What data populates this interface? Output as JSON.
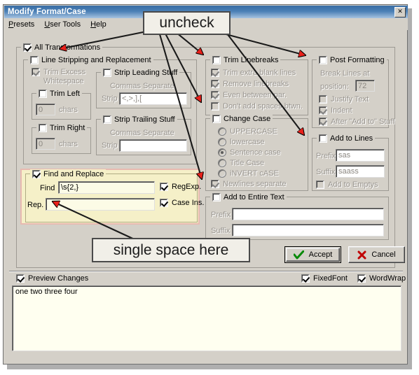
{
  "window": {
    "title": "Modify Format/Case",
    "close_label": "✕",
    "menu": [
      {
        "label": "Presets",
        "accel": "P"
      },
      {
        "label": "User Tools",
        "accel": "U"
      },
      {
        "label": "Help",
        "accel": "H"
      }
    ]
  },
  "all_transformations": {
    "label": "All Transformations",
    "checked": true
  },
  "line_stripping": {
    "label": "Line Stripping and Replacement",
    "checked": false,
    "trim_excess_whitespace": {
      "label_line1": "Trim Excess",
      "label_line2": "Whitespace",
      "checked": true,
      "enabled": false
    },
    "trim_left": {
      "label": "Trim Left",
      "checked": false,
      "value": "0",
      "units": "chars"
    },
    "trim_right": {
      "label": "Trim Right",
      "checked": false,
      "value": "0",
      "units": "chars"
    },
    "strip_leading": {
      "label": "Strip Leading Stuff",
      "checked": false,
      "hint": "Commas Separate",
      "field_label": "Strip",
      "value": "<,>,],["
    },
    "strip_trailing": {
      "label": "Strip Trailing Stuff",
      "checked": false,
      "hint": "Commas Separate",
      "field_label": "Strip",
      "value": ""
    }
  },
  "trim_linebreaks": {
    "label": "Trim Linebreaks",
    "checked": false,
    "items": [
      {
        "label": "Trim extra blank lines",
        "checked": true
      },
      {
        "label": "Remove linebreaks",
        "checked": true
      },
      {
        "label": "Even between par.",
        "checked": true
      },
      {
        "label": "Don't add spaces btwn.",
        "checked": false
      }
    ]
  },
  "change_case": {
    "label": "Change Case",
    "checked": false,
    "options": [
      {
        "label": "UPPERCASE",
        "selected": false
      },
      {
        "label": "lowercase",
        "selected": false
      },
      {
        "label": "Sentence case",
        "selected": true
      },
      {
        "label": "Title Case",
        "selected": false
      },
      {
        "label": "iNVERT cASE",
        "selected": false
      }
    ],
    "newlines_separate": {
      "label": "Newlines separate",
      "checked": true
    }
  },
  "post_formatting": {
    "label": "Post Formatting",
    "checked": false,
    "break_lines_label": "Break Lines at",
    "position_label": "position:",
    "position_value": "72",
    "items": [
      {
        "label": "Justify Text",
        "checked": false
      },
      {
        "label": "Indent",
        "checked": true
      },
      {
        "label": "After \"Add to\" Stuff",
        "checked": true
      }
    ]
  },
  "add_to_lines": {
    "label": "Add to Lines",
    "checked": false,
    "prefix_label": "Prefix",
    "prefix_value": "sas",
    "suffix_label": "Suffix",
    "suffix_value": "saass",
    "add_to_emptys": {
      "label": "Add to Emptys",
      "checked": false
    }
  },
  "find_and_replace": {
    "label": "Find and Replace",
    "checked": true,
    "find_label": "Find",
    "find_value": "\\s{2,}",
    "replace_label": "Rep.",
    "replace_value": " ",
    "regexp": {
      "label": "RegExp.",
      "checked": true
    },
    "case_ins": {
      "label": "Case Ins.",
      "checked": true
    }
  },
  "add_to_entire_text": {
    "label": "Add to Entire Text",
    "checked": false,
    "prefix_label": "Prefix",
    "prefix_value": "",
    "suffix_label": "Suffix",
    "suffix_value": ""
  },
  "buttons": {
    "accept": {
      "label": "Accept",
      "icon": "check-mark-icon",
      "color": "#0a8a0a"
    },
    "cancel": {
      "label": "Cancel",
      "icon": "x-mark-icon",
      "color": "#c00000"
    }
  },
  "bottom_bar": {
    "preview_changes": {
      "label": "Preview Changes",
      "checked": true
    },
    "fixed_font": {
      "label": "FixedFont",
      "checked": true
    },
    "word_wrap": {
      "label": "WordWrap",
      "checked": true
    }
  },
  "preview": {
    "text": "one two three four"
  },
  "annotations": {
    "uncheck": "uncheck",
    "single_space": "single space here",
    "arrow_color": "#e8211b"
  }
}
